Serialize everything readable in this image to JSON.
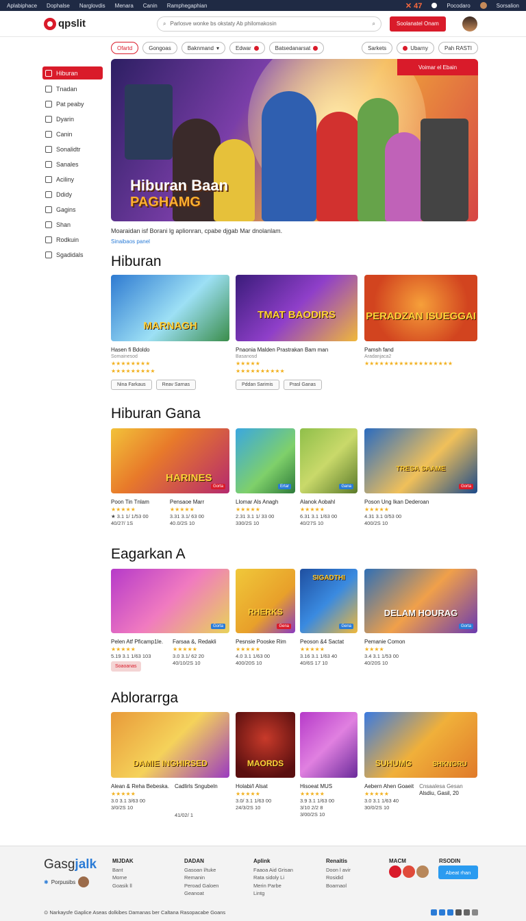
{
  "topbar": {
    "links": [
      "Aplabiphace",
      "Dophalse",
      "Narglovdis",
      "Menara",
      "Canin",
      "Ramphegaphian"
    ],
    "accent": "✕ 47",
    "right_text": "Pocodaro",
    "account": "Sorsalion"
  },
  "header": {
    "logo": "qpslit",
    "search_placeholder": "Parlosve wonke bs okstaty Ab philomakosin",
    "cta": "Soolanatel Onam"
  },
  "chips": [
    "Ofartd",
    "Gongoas",
    "Baknmand",
    "Edwar",
    "Batsedanarsat",
    "Sarkets",
    "Ubarny",
    "Pah RASTI"
  ],
  "sidebar": {
    "items": [
      "Hiburan",
      "Tnadan",
      "Pat peaby",
      "Dyarin",
      "Canin",
      "Sonalidtr",
      "Sanales",
      "Aciliny",
      "Ddidy",
      "Gagins",
      "Shan",
      "Rodkuin",
      "Sgadidals"
    ]
  },
  "hero": {
    "banner": "Voimar el Ebain",
    "title_line1": "Hiburan Baan",
    "title_line2": "PAGHAMG",
    "caption": "Moaraidan isf Borani lg aplionran, cpabe djgab Mar dnolanlam.",
    "link": "Sinaibaos panel"
  },
  "sections": [
    {
      "title": "Hiburan",
      "cards": [
        {
          "thumb_title": "MARNAGH",
          "title": "Hasen fi Bdoldo",
          "sub": "Somainesod",
          "stars": "★★★★★★★★",
          "buttons": [
            "Nina Farkaus",
            "Reav Sarnas"
          ]
        },
        {
          "thumb_title": "TMAT BAODIRS",
          "title": "Pnaonia Malden Prastrakan Bam man",
          "sub": "Basanosd",
          "stars": "★★★★★★★★★★★★",
          "buttons": [
            "Pddan Sarimis",
            "Prasl Ganas"
          ]
        },
        {
          "thumb_title": "PERADZAN ISUEGGAI",
          "title": "Pamsh fand",
          "sub": "Aradanjaca2",
          "stars": "★★★★★★★★★★★★★★★★★★",
          "buttons": []
        }
      ]
    },
    {
      "title": "Hiburan Gana",
      "cards": [
        {
          "thumb_title": "HARINES",
          "title": "Poon Tin Tnlam",
          "title2": "Pensaoe Marr",
          "stars": "★★★★★",
          "stars2": "★★★★★",
          "meta1": "★ 3.1 1/ 1/53 00",
          "meta1b": "3.31 3.1/ 63 00",
          "meta2": "40/27/ 1S",
          "meta2b": "40.0/2S 10",
          "badge": "Gorta"
        },
        {
          "thumb_title": "",
          "title": "Llomar Als Anagh",
          "stars": "★★★★★",
          "meta1": "2.31 3.1 1/ 33 00",
          "meta2": "330/2S 10",
          "badge": "Ertar"
        },
        {
          "thumb_title": "",
          "title": "Alanok Aobahl",
          "stars": "★★★★★",
          "meta1": "6.31 3.1 1/63 00",
          "meta2": "40/27S 10",
          "badge": "Gana"
        },
        {
          "thumb_title": "TRESA SAAME",
          "title": "Poson Ung Ikan Dederoan",
          "stars": "★★★★★",
          "meta1": "4.31 3.1 0/53 00",
          "meta2": "400/2S 10",
          "badge": "Gorta"
        }
      ]
    },
    {
      "title": "Eagarkan A",
      "cards": [
        {
          "thumb_title": "",
          "title": "Pelen Atf Pficamp1le.",
          "title2": "Farsaa &, Redakli",
          "stars": "★★★★★",
          "stars2": "★★★★★",
          "meta1": "5.19 3.1 1/63 103",
          "meta1b": "3.0 3.1/ 62 20",
          "meta2": "",
          "meta2b": "40/10/2S 10",
          "red_btn": "Soaoanas",
          "badge": "Gorta"
        },
        {
          "thumb_title": "RHERKS",
          "title": "Pesnsie Pooske Rim",
          "stars": "★★★★★",
          "meta1": "4.0 3.1 1/63 00",
          "meta2": "400/20S 10",
          "badge": "Gena"
        },
        {
          "thumb_title": "SIGADTHI",
          "title": "Peoson &4 Sactat",
          "stars": "★★★★★",
          "meta1": "3.16 3.1 1/63 40",
          "meta2": "40/6S 17 10",
          "badge": "Gena"
        },
        {
          "thumb_title": "DELAM HOURAG",
          "title": "Pemanie Comon",
          "stars": "★★★★",
          "meta1": "3.4 3.1 1/53 00",
          "meta2": "40/20S 10",
          "badge": "Gorta"
        }
      ]
    },
    {
      "title": "Ablorarrga",
      "cards": [
        {
          "thumb_title": "DAMIE INGHIRSED",
          "title": "Alean & Reha Bebeska.",
          "title2": "Cadlirls Sngubeln",
          "stars": "★★★★★",
          "meta1": "3.0 3.1 3/63 00",
          "meta2": "3/0/2S 10",
          "meta2b": "41/02/ 1"
        },
        {
          "thumb_title": "MAORDS",
          "title": "Holabi/I Alsat",
          "stars": "★★★★★",
          "meta1": "3.0/ 3.1 1/63 00",
          "meta2": "24/3/2S 10"
        },
        {
          "thumb_title": "",
          "title": "Hisoeat MUS",
          "stars": "★★★★★",
          "meta1": "3.9 3.1 1/63 00",
          "meta2": "3/10 2/2 8",
          "meta3": "3/00/2S 10"
        },
        {
          "thumb_title": "SUHUMG",
          "title": "Aebern Ahen Goaeit",
          "title2": "Cnsaalesa Gesan",
          "title3": "Alsdiu, Gasil, 20",
          "stars": "★★★★★",
          "meta1": "3.0 3.1 1/63 40",
          "meta2": "30/0/2S 10",
          "badge2": "SHKNGRU"
        }
      ]
    }
  ],
  "footer": {
    "brand_a": "Gasg",
    "brand_b": "jalk",
    "tag": "Porpusibs",
    "cols": [
      {
        "h": "MIJDAK",
        "items": [
          "Bant",
          "Morne",
          "Goasik ll"
        ]
      },
      {
        "h": "DADAN",
        "items": [
          "Gasoan l/tuke",
          "Remanin",
          "Peroad Galoen",
          "Geanoat"
        ]
      },
      {
        "h": "Aplink",
        "items": [
          "Faaoa Aid Grisan",
          "Rata sidoly Li",
          "Merin Parbe",
          "Lintg"
        ]
      },
      {
        "h": "Renaitis",
        "items": [
          "Doon l avir",
          "Rosidid",
          "Boarnaol"
        ]
      },
      {
        "h": "MACM",
        "items": []
      },
      {
        "h": "RSODIN",
        "items": []
      }
    ],
    "blue_btn": "Abeat rhan",
    "bottom": "Narkaysfe Gaplice Aseas dolkibes Damanas ber Caltana Rasopacabe Goans"
  },
  "colors": {
    "brand_red": "#d91b2a",
    "topbar": "#1f2a44",
    "link_blue": "#2a7bd6",
    "star": "#f2b01e"
  }
}
